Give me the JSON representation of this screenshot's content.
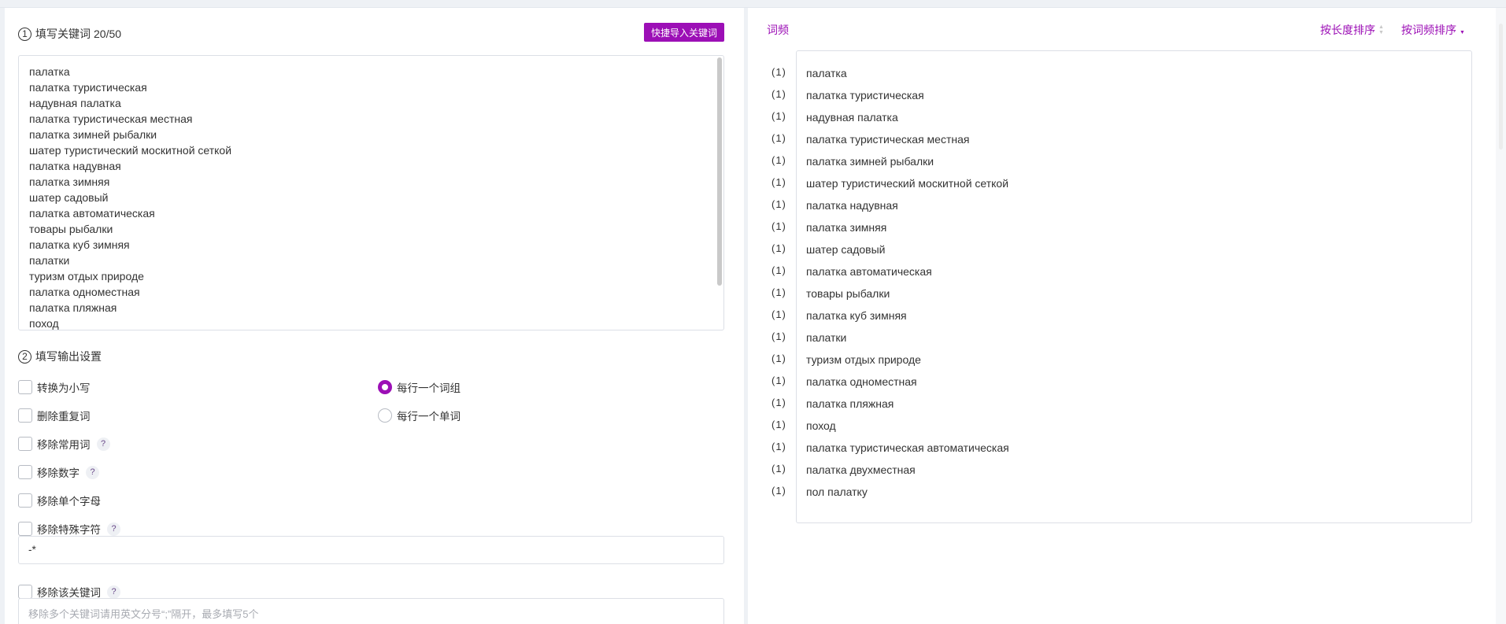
{
  "left": {
    "step1": {
      "num": "1",
      "title": "填写关键词",
      "count": "20/50"
    },
    "import_button": "快捷导入关键词",
    "keywords": [
      "палатка",
      "палатка туристическая",
      "надувная палатка",
      "палатка туристическая местная",
      "палатка зимней рыбалки",
      "шатер туристический москитной сеткой",
      "палатка надувная",
      "палатка зимняя",
      "шатер садовый",
      "палатка автоматическая",
      "товары рыбалки",
      "палатка куб зимняя",
      "палатки",
      "туризм отдых природе",
      "палатка одноместная",
      "палатка пляжная",
      "поход"
    ],
    "step2": {
      "num": "2",
      "title": "填写输出设置"
    },
    "options": {
      "lowercase": "转换为小写",
      "remove_duplicates": "删除重复词",
      "remove_common": "移除常用词",
      "remove_numbers": "移除数字",
      "remove_single_letters": "移除单个字母",
      "remove_special_chars": "移除特殊字符",
      "remove_keywords": "移除该关键词",
      "per_line_phrase": "每行一个词组",
      "per_line_word": "每行一个单词",
      "help": "?"
    },
    "special_chars_value": "-*",
    "remove_keywords_placeholder": "移除多个关键词请用英文分号“;”隔开，最多填写5个"
  },
  "right": {
    "freq_label": "词频",
    "sort_by_length": "按长度排序",
    "sort_by_frequency": "按词频排序",
    "counts": [
      "(1)",
      "(1)",
      "(1)",
      "(1)",
      "(1)",
      "(1)",
      "(1)",
      "(1)",
      "(1)",
      "(1)",
      "(1)",
      "(1)",
      "(1)",
      "(1)",
      "(1)",
      "(1)",
      "(1)",
      "(1)",
      "(1)",
      "(1)"
    ],
    "results": [
      "палатка",
      "палатка туристическая",
      "надувная палатка",
      "палатка туристическая местная",
      "палатка зимней рыбалки",
      "шатер туристический москитной сеткой",
      "палатка надувная",
      "палатка зимняя",
      "шатер садовый",
      "палатка автоматическая",
      "товары рыбалки",
      "палатка куб зимняя",
      "палатки",
      "туризм отдых природе",
      "палатка одноместная",
      "палатка пляжная",
      "поход",
      "палатка туристическая автоматическая",
      "палатка двухместная",
      "пол палатку"
    ]
  },
  "colors": {
    "accent": "#9c0fb6",
    "border": "#dcdfe6",
    "background": "#eef1f5"
  }
}
